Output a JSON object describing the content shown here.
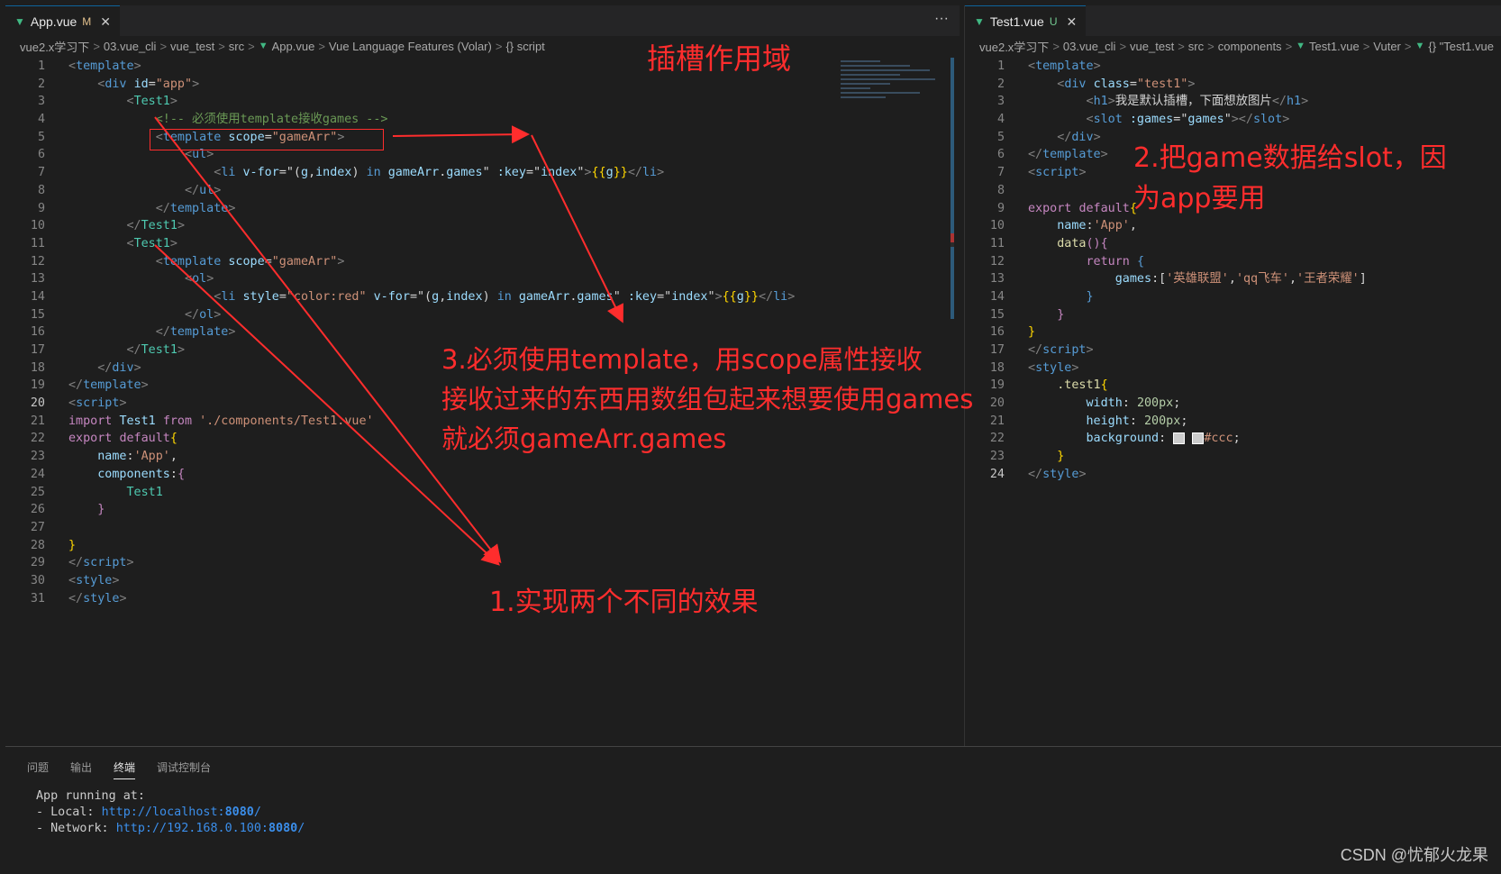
{
  "left": {
    "tab": {
      "label": "App.vue",
      "badge": "M"
    },
    "breadcrumb": [
      "vue2.x学习下",
      "03.vue_cli",
      "vue_test",
      "src",
      "App.vue",
      "Vue Language Features (Volar)",
      "{} script"
    ],
    "lines": [
      {
        "n": "1",
        "h": "<span class='t-tag'>&lt;</span><span class='t-name'>template</span><span class='t-tag'>&gt;</span>"
      },
      {
        "n": "2",
        "h": "    <span class='t-tag'>&lt;</span><span class='t-name'>div</span> <span class='t-attr'>id</span><span class='t-white'>=</span><span class='t-str'>\"app\"</span><span class='t-tag'>&gt;</span>"
      },
      {
        "n": "3",
        "h": "        <span class='t-tag'>&lt;</span><span class='t-comp'>Test1</span><span class='t-tag'>&gt;</span>"
      },
      {
        "n": "4",
        "h": "            <span class='t-com'>&lt;!-- 必须使用template接收games --&gt;</span>"
      },
      {
        "n": "5",
        "h": "            <span class='t-tag'>&lt;</span><span class='t-name'>template</span> <span class='t-attr'>scope</span><span class='t-white'>=</span><span class='t-str'>\"gameArr\"</span><span class='t-tag'>&gt;</span>"
      },
      {
        "n": "6",
        "h": "                <span class='t-tag'>&lt;</span><span class='t-name'>ul</span><span class='t-tag'>&gt;</span>"
      },
      {
        "n": "7",
        "h": "                    <span class='t-tag'>&lt;</span><span class='t-name'>li</span> <span class='t-attr'>v-for</span><span class='t-white'>=</span><span class='t-white'>\"(</span><span class='t-id'>g</span><span class='t-white'>,</span><span class='t-id'>index</span><span class='t-white'>) </span><span class='t-name'>in</span> <span class='t-id'>gameArr</span><span class='t-white'>.</span><span class='t-id'>games</span><span class='t-white'>\"</span> <span class='t-attr'>:key</span><span class='t-white'>=</span><span class='t-white'>\"</span><span class='t-id'>index</span><span class='t-white'>\"</span><span class='t-tag'>&gt;</span><span class='t-punc'>{{</span><span class='t-id'>g</span><span class='t-punc'>}}</span><span class='t-tag'>&lt;/</span><span class='t-name'>li</span><span class='t-tag'>&gt;</span>"
      },
      {
        "n": "8",
        "h": "                <span class='t-tag'>&lt;/</span><span class='t-name'>ul</span><span class='t-tag'>&gt;</span>"
      },
      {
        "n": "9",
        "h": "            <span class='t-tag'>&lt;/</span><span class='t-name'>template</span><span class='t-tag'>&gt;</span>"
      },
      {
        "n": "10",
        "h": "        <span class='t-tag'>&lt;/</span><span class='t-comp'>Test1</span><span class='t-tag'>&gt;</span>"
      },
      {
        "n": "11",
        "h": "        <span class='t-tag'>&lt;</span><span class='t-comp'>Test1</span><span class='t-tag'>&gt;</span>"
      },
      {
        "n": "12",
        "h": "            <span class='t-tag'>&lt;</span><span class='t-name'>template</span> <span class='t-attr'>scope</span><span class='t-white'>=</span><span class='t-str'>\"gameArr\"</span><span class='t-tag'>&gt;</span>"
      },
      {
        "n": "13",
        "h": "                <span class='t-tag'>&lt;</span><span class='t-name'>ol</span><span class='t-tag'>&gt;</span>"
      },
      {
        "n": "14",
        "h": "                    <span class='t-tag'>&lt;</span><span class='t-name'>li</span> <span class='t-attr'>style</span><span class='t-white'>=</span><span class='t-str'>\"color:red\"</span> <span class='t-attr'>v-for</span><span class='t-white'>=</span><span class='t-white'>\"(</span><span class='t-id'>g</span><span class='t-white'>,</span><span class='t-id'>index</span><span class='t-white'>) </span><span class='t-name'>in</span> <span class='t-id'>gameArr</span><span class='t-white'>.</span><span class='t-id'>games</span><span class='t-white'>\"</span> <span class='t-attr'>:key</span><span class='t-white'>=</span><span class='t-white'>\"</span><span class='t-id'>index</span><span class='t-white'>\"</span><span class='t-tag'>&gt;</span><span class='t-punc'>{{</span><span class='t-id'>g</span><span class='t-punc'>}}</span><span class='t-tag'>&lt;/</span><span class='t-name'>li</span><span class='t-tag'>&gt;</span>"
      },
      {
        "n": "15",
        "h": "                <span class='t-tag'>&lt;/</span><span class='t-name'>ol</span><span class='t-tag'>&gt;</span>"
      },
      {
        "n": "16",
        "h": "            <span class='t-tag'>&lt;/</span><span class='t-name'>template</span><span class='t-tag'>&gt;</span>"
      },
      {
        "n": "17",
        "h": "        <span class='t-tag'>&lt;/</span><span class='t-comp'>Test1</span><span class='t-tag'>&gt;</span>"
      },
      {
        "n": "18",
        "h": "    <span class='t-tag'>&lt;/</span><span class='t-name'>div</span><span class='t-tag'>&gt;</span>"
      },
      {
        "n": "19",
        "h": "<span class='t-tag'>&lt;/</span><span class='t-name'>template</span><span class='t-tag'>&gt;</span>"
      },
      {
        "n": "20",
        "h": "<span class='t-tag'>&lt;</span><span class='t-name'>script</span><span class='t-tag'>&gt;</span>"
      },
      {
        "n": "21",
        "h": "<span class='t-kw'>import</span> <span class='t-id'>Test1</span> <span class='t-kw'>from</span> <span class='t-str'>'./components/Test1.vue'</span>"
      },
      {
        "n": "22",
        "h": "<span class='t-kw'>export</span> <span class='t-kw'>default</span><span class='t-punc'>{</span>"
      },
      {
        "n": "23",
        "h": "    <span class='t-id'>name</span><span class='t-white'>:</span><span class='t-str'>'App'</span><span class='t-white'>,</span>"
      },
      {
        "n": "24",
        "h": "    <span class='t-id'>components</span><span class='t-white'>:</span><span class='t-kw'>{</span>"
      },
      {
        "n": "25",
        "h": "        <span class='t-comp'>Test1</span>"
      },
      {
        "n": "26",
        "h": "    <span class='t-kw'>}</span>"
      },
      {
        "n": "27",
        "h": ""
      },
      {
        "n": "28",
        "h": "<span class='t-punc'>}</span>"
      },
      {
        "n": "29",
        "h": "<span class='t-tag'>&lt;/</span><span class='t-name'>script</span><span class='t-tag'>&gt;</span>"
      },
      {
        "n": "30",
        "h": "<span class='t-tag'>&lt;</span><span class='t-name'>style</span><span class='t-tag'>&gt;</span>"
      },
      {
        "n": "31",
        "h": "<span class='t-tag'>&lt;/</span><span class='t-name'>style</span><span class='t-tag'>&gt;</span>"
      }
    ],
    "active_line": "20"
  },
  "right": {
    "tab": {
      "label": "Test1.vue",
      "badge": "U"
    },
    "breadcrumb": [
      "vue2.x学习下",
      "03.vue_cli",
      "vue_test",
      "src",
      "components",
      "Test1.vue",
      "Vuter",
      "{} \"Test1.vue"
    ],
    "lines": [
      {
        "n": "1",
        "h": "<span class='t-tag'>&lt;</span><span class='t-name'>template</span><span class='t-tag'>&gt;</span>"
      },
      {
        "n": "2",
        "h": "    <span class='t-tag'>&lt;</span><span class='t-name'>div</span> <span class='t-attr'>class</span><span class='t-white'>=</span><span class='t-str'>\"test1\"</span><span class='t-tag'>&gt;</span>"
      },
      {
        "n": "3",
        "h": "        <span class='t-tag'>&lt;</span><span class='t-name'>h1</span><span class='t-tag'>&gt;</span><span class='t-white'>我是默认插槽，下面想放图片</span><span class='t-tag'>&lt;/</span><span class='t-name'>h1</span><span class='t-tag'>&gt;</span>"
      },
      {
        "n": "4",
        "h": "        <span class='t-tag'>&lt;</span><span class='t-name'>slot</span> <span class='t-attr'>:games</span><span class='t-white'>=</span><span class='t-white'>\"</span><span class='t-id'>games</span><span class='t-white'>\"</span><span class='t-tag'>&gt;&lt;/</span><span class='t-name'>slot</span><span class='t-tag'>&gt;</span>"
      },
      {
        "n": "5",
        "h": "    <span class='t-tag'>&lt;/</span><span class='t-name'>div</span><span class='t-tag'>&gt;</span>"
      },
      {
        "n": "6",
        "h": "<span class='t-tag'>&lt;/</span><span class='t-name'>template</span><span class='t-tag'>&gt;</span>"
      },
      {
        "n": "7",
        "h": "<span class='t-tag'>&lt;</span><span class='t-name'>script</span><span class='t-tag'>&gt;</span>"
      },
      {
        "n": "8",
        "h": ""
      },
      {
        "n": "9",
        "h": "<span class='t-kw'>export</span> <span class='t-kw'>default</span><span class='t-punc'>{</span>"
      },
      {
        "n": "10",
        "h": "    <span class='t-id'>name</span><span class='t-white'>:</span><span class='t-str'>'App'</span><span class='t-white'>,</span>"
      },
      {
        "n": "11",
        "h": "    <span class='t-fn'>data</span><span class='t-kw'>(){</span>"
      },
      {
        "n": "12",
        "h": "        <span class='t-kw'>return</span> <span class='t-name'>{</span>"
      },
      {
        "n": "13",
        "h": "            <span class='t-id'>games</span><span class='t-white'>:[</span><span class='t-str'>'英雄联盟'</span><span class='t-white'>,</span><span class='t-str'>'qq飞车'</span><span class='t-white'>,</span><span class='t-str'>'王者荣耀'</span><span class='t-white'>]</span>"
      },
      {
        "n": "14",
        "h": "        <span class='t-name'>}</span>"
      },
      {
        "n": "15",
        "h": "    <span class='t-kw'>}</span>"
      },
      {
        "n": "16",
        "h": "<span class='t-punc'>}</span>"
      },
      {
        "n": "17",
        "h": "<span class='t-tag'>&lt;/</span><span class='t-name'>script</span><span class='t-tag'>&gt;</span>"
      },
      {
        "n": "18",
        "h": "<span class='t-tag'>&lt;</span><span class='t-name'>style</span><span class='t-tag'>&gt;</span>"
      },
      {
        "n": "19",
        "h": "    <span class='t-fn'>.test1</span><span class='t-punc'>{</span>"
      },
      {
        "n": "20",
        "h": "        <span class='t-attr'>width</span><span class='t-white'>: </span><span class='t-num'>200px</span><span class='t-white'>;</span>"
      },
      {
        "n": "21",
        "h": "        <span class='t-attr'>height</span><span class='t-white'>: </span><span class='t-num'>200px</span><span class='t-white'>;</span>"
      },
      {
        "n": "22",
        "h": "        <span class='t-attr'>background</span><span class='t-white'>: </span><span style='display:inline-block;width:11px;height:11px;background:#ccc;border:1px solid #fff;vertical-align:middle'></span> <span style='display:inline-block;width:11px;height:11px;background:#ccc;border:1px solid #fff;vertical-align:middle'></span><span class='t-str'>#ccc</span><span class='t-white'>;</span>"
      },
      {
        "n": "23",
        "h": "    <span class='t-punc'>}</span>"
      },
      {
        "n": "24",
        "h": "<span class='t-tag'>&lt;/</span><span class='t-name'>style</span><span class='t-tag'>&gt;</span>"
      }
    ],
    "active_line": "24"
  },
  "panel": {
    "tabs": [
      "问题",
      "输出",
      "终端",
      "调试控制台"
    ],
    "active_tab": "终端",
    "terminal": {
      "line1": "App running at:",
      "local_label": "- Local:   ",
      "local_url": "http://localhost:",
      "local_port": "8080",
      "local_slash": "/",
      "net_label": "- Network: ",
      "net_url": "http://192.168.0.100:",
      "net_port": "8080",
      "net_slash": "/"
    }
  },
  "annotations": {
    "title": "插槽作用域",
    "note2_line1": "2.把game数据给slot，因",
    "note2_line2": "为app要用",
    "note3_line1": "3.必须使用template，用scope属性接收",
    "note3_line2": "接收过来的东西用数组包起来想要使用games",
    "note3_line3": "就必须gameArr.games",
    "note1": "1.实现两个不同的效果"
  },
  "watermark": "CSDN @忧郁火龙果",
  "colors": {
    "annotation": "#ff2d2d",
    "editor_bg": "#1e1e1e",
    "vue_icon": "#41b883"
  }
}
